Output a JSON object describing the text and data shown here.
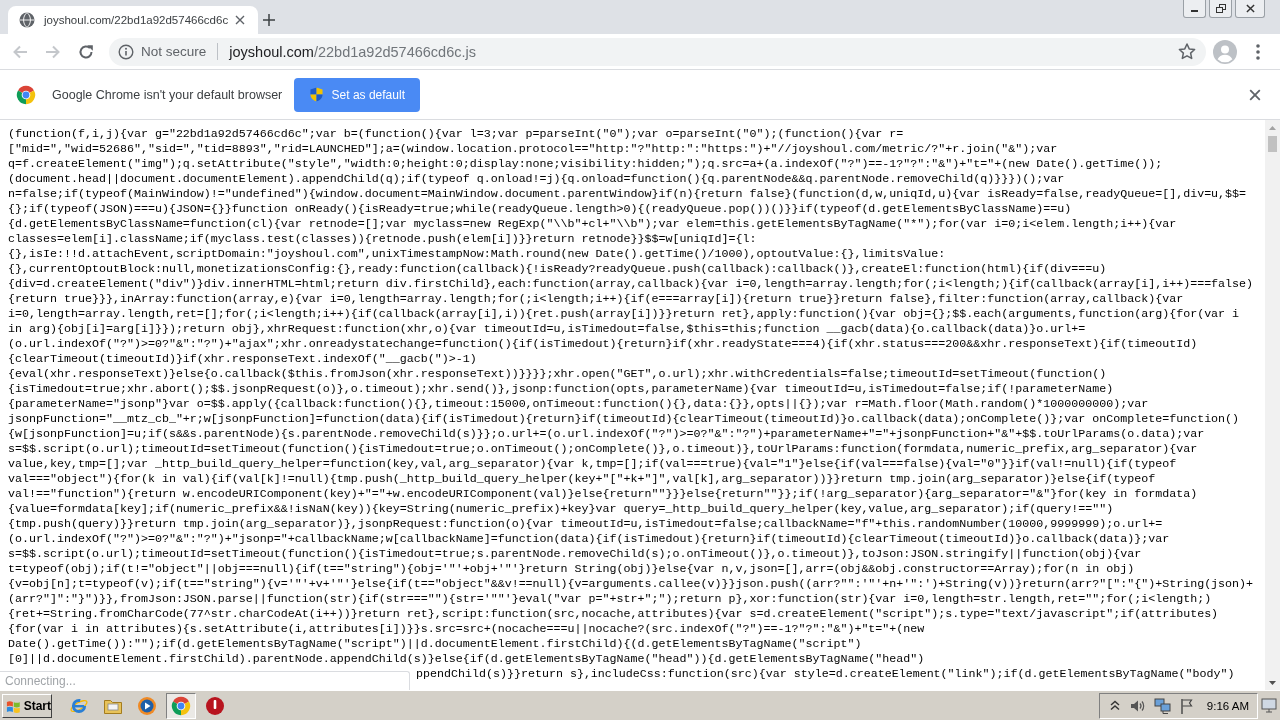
{
  "browser": {
    "tabs": [
      {
        "title": "joyshoul.com/22bd1a92d57466cd6c",
        "selected": true
      }
    ]
  },
  "toolbar": {
    "navigation": [
      {
        "kind": "back",
        "disabled": true
      },
      {
        "kind": "forward",
        "disabled": true
      },
      {
        "kind": "reload",
        "disabled": false
      }
    ],
    "address_bar": {
      "security_label": "Not secure",
      "url_host": "joyshoul.com",
      "url_path": "/22bd1a92d57466cd6c.js"
    }
  },
  "infobar": {
    "message": "Google Chrome isn't your default browser",
    "button": "Set as default"
  },
  "page": {
    "code_lines": [
      "(function(f,i,j){var g=\"22bd1a92d57466cd6c\";var b=(function(){var l=3;var p=parseInt(\"0\");var o=parseInt(\"0\");(function(){var r=",
      "[\"mid=\",\"wid=52686\",\"sid=\",\"tid=8893\",\"rid=LAUNCHED\"];a=(window.location.protocol==\"http:\"?\"http:\":\"https:\")+\"//joyshoul.com/metric/?\"+r.join(\"&\");var",
      "q=f.createElement(\"img\");q.setAttribute(\"style\",\"width:0;height:0;display:none;visibility:hidden;\");q.src=a+(a.indexOf(\"?\")==-1?\"?\":\"&\")+\"t=\"+(new Date().getTime());",
      "(document.head||document.documentElement).appendChild(q);if(typeof q.onload!=j){q.onload=function(){q.parentNode&&q.parentNode.removeChild(q)}}})();var",
      "n=false;if(typeof(MainWindow)!=\"undefined\"){window.document=MainWindow.document.parentWindow}if(n){return false}(function(d,w,uniqId,u){var isReady=false,readyQueue=[],div=u,$$=",
      "{};if(typeof(JSON)===u){JSON={}}function onReady(){isReady=true;while(readyQueue.length>0){(readyQueue.pop())()}}if(typeof(d.getElementsByClassName)==u)",
      "{d.getElementsByClassName=function(cl){var retnode=[];var myclass=new RegExp(\"\\\\b\"+cl+\"\\\\b\");var elem=this.getElementsByTagName(\"*\");for(var i=0;i<elem.length;i++){var",
      "classes=elem[i].className;if(myclass.test(classes)){retnode.push(elem[i])}}return retnode}}$$=w[uniqId]={l:",
      "{},isIe:!!d.attachEvent,scriptDomain:\"joyshoul.com\",unixTimestampNow:Math.round(new Date().getTime()/1000),optoutValue:{},limitsValue:",
      "{},currentOptoutBlock:null,monetizationsConfig:{},ready:function(callback){!isReady?readyQueue.push(callback):callback()},createEl:function(html){if(div===u)",
      "{div=d.createElement(\"div\")}div.innerHTML=html;return div.firstChild},each:function(array,callback){var i=0,length=array.length;for(;i<length;){if(callback(array[i],i++)===false)",
      "{return true}}},inArray:function(array,e){var i=0,length=array.length;for(;i<length;i++){if(e===array[i]){return true}}return false},filter:function(array,callback){var",
      "i=0,length=array.length,ret=[];for(;i<length;i++){if(callback(array[i],i)){ret.push(array[i])}}return ret},apply:function(){var obj={};$$.each(arguments,function(arg){for(var i",
      "in arg){obj[i]=arg[i]}});return obj},xhrRequest:function(xhr,o){var timeoutId=u,isTimedout=false,$this=this;function __gacb(data){o.callback(data)}o.url+=",
      "(o.url.indexOf(\"?\")>=0?\"&\":\"?\")+\"ajax\";xhr.onreadystatechange=function(){if(isTimedout){return}if(xhr.readyState===4){if(xhr.status===200&&xhr.responseText){if(timeoutId)",
      "{clearTimeout(timeoutId)}if(xhr.responseText.indexOf(\"__gacb(\")>-1)",
      "{eval(xhr.responseText)}else{o.callback($this.fromJson(xhr.responseText))}}}};xhr.open(\"GET\",o.url);xhr.withCredentials=false;timeoutId=setTimeout(function()",
      "{isTimedout=true;xhr.abort();$$.jsonpRequest(o)},o.timeout);xhr.send()},jsonp:function(opts,parameterName){var timeoutId=u,isTimedout=false;if(!parameterName)",
      "{parameterName=\"jsonp\"}var o=$$.apply({callback:function(){},timeout:15000,onTimeout:function(){},data:{}},opts||{});var r=Math.floor(Math.random()*1000000000);var",
      "jsonpFunction=\"__mtz_cb_\"+r;w[jsonpFunction]=function(data){if(isTimedout){return}if(timeoutId){clearTimeout(timeoutId)}o.callback(data);onComplete()};var onComplete=function()",
      "{w[jsonpFunction]=u;if(s&&s.parentNode){s.parentNode.removeChild(s)}};o.url+=(o.url.indexOf(\"?\")>=0?\"&\":\"?\")+parameterName+\"=\"+jsonpFunction+\"&\"+$$.toUrlParams(o.data);var",
      "s=$$.script(o.url);timeoutId=setTimeout(function(){isTimedout=true;o.onTimeout();onComplete()},o.timeout)},toUrlParams:function(formdata,numeric_prefix,arg_separator){var",
      "value,key,tmp=[];var _http_build_query_helper=function(key,val,arg_separator){var k,tmp=[];if(val===true){val=\"1\"}else{if(val===false){val=\"0\"}}if(val!=null){if(typeof",
      "val===\"object\"){for(k in val){if(val[k]!=null){tmp.push(_http_build_query_helper(key+\"[\"+k+\"]\",val[k],arg_separator))}}return tmp.join(arg_separator)}else{if(typeof",
      "val!==\"function\"){return w.encodeURIComponent(key)+\"=\"+w.encodeURIComponent(val)}else{return\"\"}}}else{return\"\"}};if(!arg_separator){arg_separator=\"&\"}for(key in formdata)",
      "{value=formdata[key];if(numeric_prefix&&!isNaN(key)){key=String(numeric_prefix)+key}var query=_http_build_query_helper(key,value,arg_separator);if(query!==\"\")",
      "{tmp.push(query)}}return tmp.join(arg_separator)},jsonpRequest:function(o){var timeoutId=u,isTimedout=false;callbackName=\"f\"+this.randomNumber(10000,9999999);o.url+=",
      "(o.url.indexOf(\"?\")>=0?\"&\":\"?\")+\"jsonp=\"+callbackName;w[callbackName]=function(data){if(isTimedout){return}if(timeoutId){clearTimeout(timeoutId)}o.callback(data)};var",
      "s=$$.script(o.url);timeoutId=setTimeout(function(){isTimedout=true;s.parentNode.removeChild(s);o.onTimeout()},o.timeout)},toJson:JSON.stringify||function(obj){var",
      "t=typeof(obj);if(t!=\"object\"||obj===null){if(t==\"string\"){obj='\"'+obj+'\"'}return String(obj)}else{var n,v,json=[],arr=(obj&&obj.constructor==Array);for(n in obj)",
      "{v=obj[n];t=typeof(v);if(t==\"string\"){v='\"'+v+'\"'}else{if(t==\"object\"&&v!==null){v=arguments.callee(v)}}json.push((arr?\"\":'\"'+n+'\":')+String(v))}return(arr?\"[\":\"{\")+String(json)+",
      "(arr?\"]\":\"}\")}},fromJson:JSON.parse||function(str){if(str===\"\"){str='\"\"'}eval(\"var p=\"+str+\";\");return p},xor:function(str){var i=0,length=str.length,ret=\"\";for(;i<length;)",
      "{ret+=String.fromCharCode(77^str.charCodeAt(i++))}return ret},script:function(src,nocache,attributes){var s=d.createElement(\"script\");s.type=\"text/javascript\";if(attributes)",
      "{for(var i in attributes){s.setAttribute(i,attributes[i])}}s.src=src+(nocache===u||nocache?(src.indexOf(\"?\")==-1?\"?\":\"&\")+\"t=\"+(new",
      "Date().getTime()):\"\");if(d.getElementsByTagName(\"script\")||d.documentElement.firstChild){(d.getElementsByTagName(\"script\")",
      "[0]||d.documentElement.firstChild).parentNode.appendChild(s)}else{if(d.getElementsByTagName(\"head\")){d.getElementsByTagName(\"head\")",
      "ppendChild(s)}}return s},includeCss:function(src){var style=d.createElement(\"link\");if(d.getElementsByTagName(\"body\")"
    ],
    "status_bubble": "Connecting..."
  },
  "taskbar": {
    "start_button": "Start",
    "apps": [
      {
        "kind": "ie",
        "selected": false
      },
      {
        "kind": "folder",
        "selected": false
      },
      {
        "kind": "media",
        "selected": false
      },
      {
        "kind": "chrome",
        "selected": true
      },
      {
        "kind": "alert",
        "selected": false
      }
    ],
    "clock": "9:16 AM"
  }
}
